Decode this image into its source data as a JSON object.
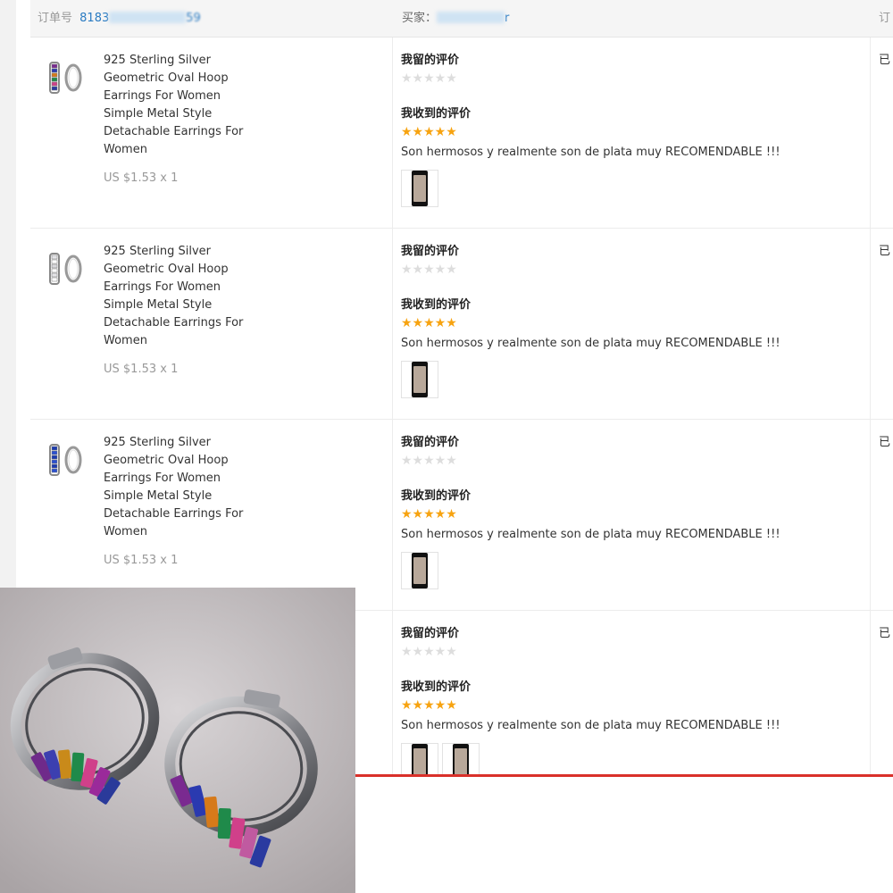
{
  "header": {
    "order_label": "订单号",
    "order_prefix": "8183",
    "order_suffix": "59",
    "buyer_label": "买家：",
    "buyer_suffix": "r",
    "status_head": "订"
  },
  "labels": {
    "my_review": "我留的评价",
    "received_review": "我收到的评价",
    "empty_stars": "★★★★★",
    "full_stars": "★★★★★",
    "status_partial": "已"
  },
  "rows": [
    {
      "title": "925 Sterling Silver Geometric Oval Hoop Earrings For Women Simple Metal Style Detachable Earrings For Women",
      "price": "US $1.53 x 1",
      "comment": "Son hermosos y realmente son de plata muy RECOMENDABLE !!!",
      "variant": "rainbow"
    },
    {
      "title": "925 Sterling Silver Geometric Oval Hoop Earrings For Women Simple Metal Style Detachable Earrings For Women",
      "price": "US $1.53 x 1",
      "comment": "Son hermosos y realmente son de plata muy RECOMENDABLE !!!",
      "variant": "silver"
    },
    {
      "title": "925 Sterling Silver Geometric Oval Hoop Earrings For Women Simple Metal Style Detachable Earrings For Women",
      "price": "US $1.53 x 1",
      "comment": "Son hermosos y realmente son de plata muy RECOMENDABLE !!!",
      "variant": "blue"
    },
    {
      "title": "",
      "price": "",
      "comment": "Son hermosos y realmente son de plata muy RECOMENDABLE !!!",
      "variant": "rainbow"
    }
  ],
  "colors": {
    "star_active": "#f7a310",
    "star_inactive": "#dddddd",
    "link_blue": "#2a7bc2",
    "annotation_red": "#d9302a"
  }
}
